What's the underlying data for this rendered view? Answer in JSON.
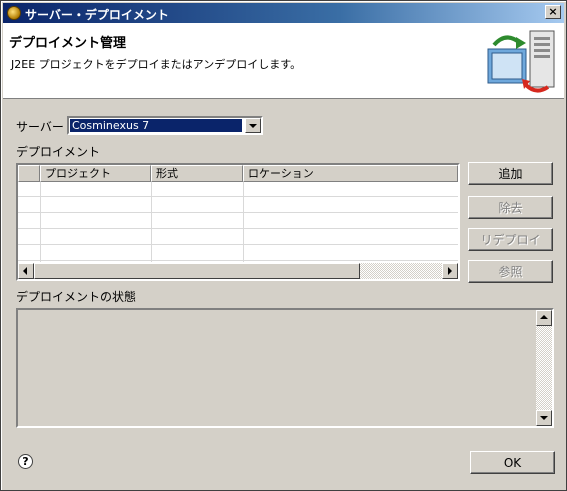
{
  "window": {
    "title": "サーバー・デプロイメント",
    "close_label": "×"
  },
  "header": {
    "title": "デプロイメント管理",
    "description": "J2EE プロジェクトをデプロイまたはアンデプロイします。"
  },
  "server": {
    "label": "サーバー",
    "selected": "Cosminexus 7"
  },
  "deployment": {
    "label": "デプロイメント",
    "columns": [
      "",
      "プロジェクト",
      "形式",
      "ロケーション"
    ],
    "rows": []
  },
  "actions": {
    "add": "追加",
    "remove": "除去",
    "redeploy": "リデプロイ",
    "browse": "参照"
  },
  "status": {
    "label": "デプロイメントの状態"
  },
  "footer": {
    "help": "?",
    "ok": "OK"
  }
}
